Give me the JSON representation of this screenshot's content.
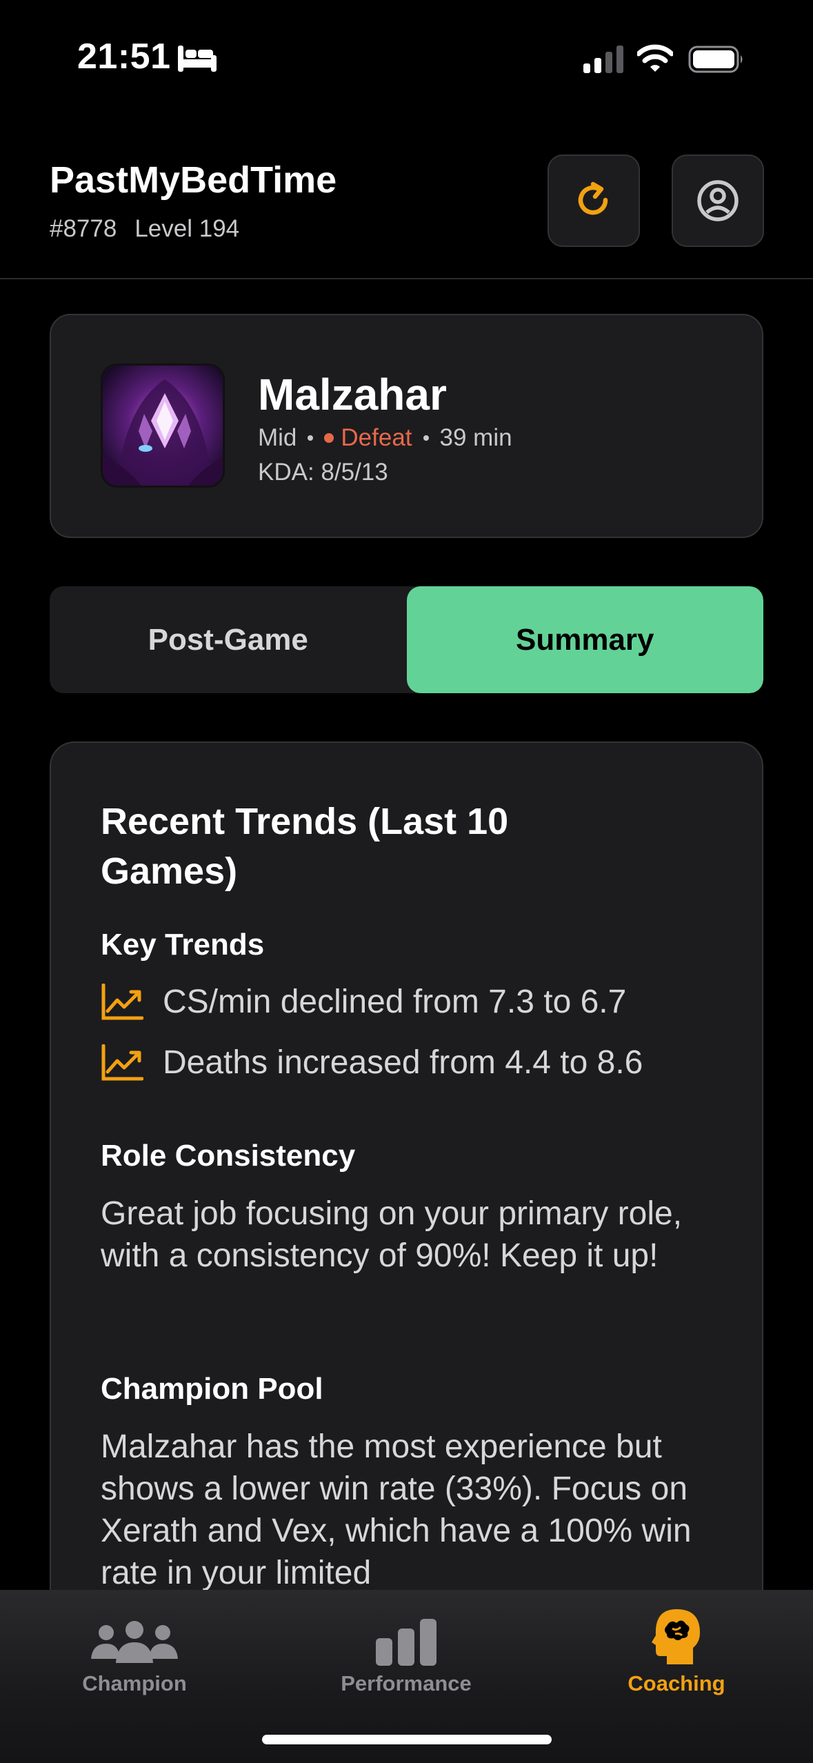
{
  "status_bar": {
    "time": "21:51",
    "icons": [
      "bed-icon",
      "cellular-signal-icon",
      "wifi-icon",
      "battery-icon"
    ]
  },
  "header": {
    "username": "PastMyBedTime",
    "tag": "#8778",
    "level": "Level 194",
    "buttons": [
      "refresh-icon",
      "profile-icon"
    ],
    "accent_color": "#f2a112"
  },
  "match": {
    "champion": "Malzahar",
    "role": "Mid",
    "result": "Defeat",
    "result_color": "#e8684a",
    "duration": "39 min",
    "kda": "KDA: 8/5/13"
  },
  "segmented": {
    "tabs": [
      {
        "label": "Post-Game",
        "selected": false
      },
      {
        "label": "Summary",
        "selected": true
      }
    ],
    "active_color": "#63d297"
  },
  "summary": {
    "title": "Recent Trends (Last 10 Games)",
    "key_trends_heading": "Key Trends",
    "trends": [
      "CS/min declined from 7.3 to 6.7",
      "Deaths increased from 4.4 to 8.6"
    ],
    "role_heading": "Role Consistency",
    "role_text": "Great job focusing on your primary role, with a consistency of 90%! Keep it up!",
    "pool_heading": "Champion Pool",
    "pool_text": "Malzahar has the most experience but shows a lower win rate (33%). Focus on Xerath and Vex, which have a 100% win rate in your limited"
  },
  "tab_bar": {
    "tabs": [
      {
        "label": "Champion",
        "icon": "people-icon",
        "selected": false
      },
      {
        "label": "Performance",
        "icon": "bar-chart-icon",
        "selected": false
      },
      {
        "label": "Coaching",
        "icon": "brain-head-icon",
        "selected": true
      }
    ]
  }
}
